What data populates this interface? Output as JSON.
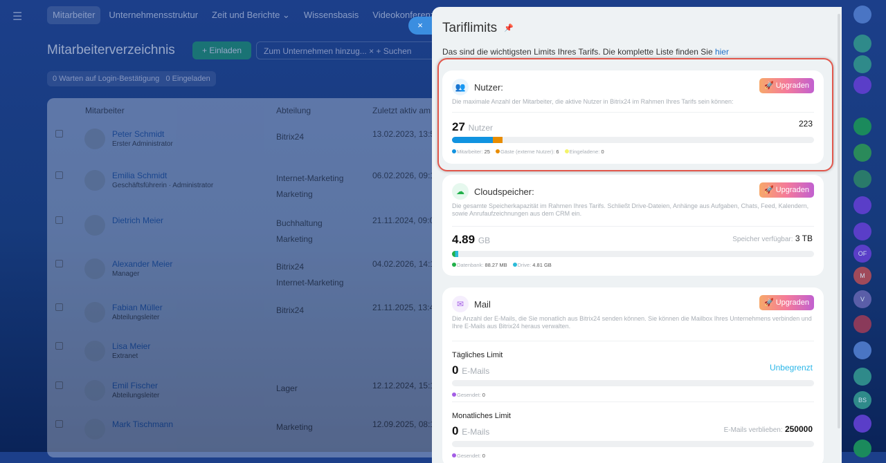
{
  "nav": {
    "tabs": [
      "Mitarbeiter",
      "Unternehmensstruktur",
      "Zeit und Berichte ⌄",
      "Wissensbasis",
      "Videokonferenzen"
    ]
  },
  "page": {
    "title": "Mitarbeiterverzeichnis",
    "invite": "+ Einladen",
    "filter": "Zum Unternehmen hinzug...  ×  + Suchen",
    "chip1": "0 Warten auf Login-Bestätigung",
    "chip2": "0 Eingeladen"
  },
  "table": {
    "headers": [
      "Mitarbeiter",
      "Abteilung",
      "Zuletzt aktiv am"
    ],
    "rows": [
      {
        "name": "Peter Schmidt",
        "pos": "Erster Administrator",
        "dep": "Bitrix24",
        "date": "13.02.2023, 13:5"
      },
      {
        "name": "Emilia Schmidt",
        "pos": "Geschäftsführerin · Administrator",
        "dep": "Internet-Marketing\nMarketing",
        "date": "06.02.2026, 09:1"
      },
      {
        "name": "Dietrich Meier",
        "pos": "",
        "dep": "Buchhaltung\nMarketing",
        "date": "21.11.2024, 09:0"
      },
      {
        "name": "Alexander Meier",
        "pos": "Manager",
        "dep": "Bitrix24\nInternet-Marketing",
        "date": "04.02.2026, 14:1"
      },
      {
        "name": "Fabian Müller",
        "pos": "Abteilungsleiter",
        "dep": "Bitrix24",
        "date": "21.11.2025, 13:4"
      },
      {
        "name": "Lisa Meier",
        "pos": "Extranet",
        "dep": "",
        "date": ""
      },
      {
        "name": "Emil Fischer",
        "pos": "Abteilungsleiter",
        "dep": "Lager",
        "date": "12.12.2024, 15:1"
      },
      {
        "name": "Mark Tischmann",
        "pos": "",
        "dep": "Marketing",
        "date": "12.09.2025, 08:1"
      }
    ]
  },
  "right_sidebar": {
    "badges": [
      "OF",
      "M",
      "V",
      "BS"
    ]
  },
  "panel": {
    "close": "×",
    "title": "Tariflimits",
    "intro": "Das sind die wichtigsten Limits Ihres Tarifs. Die komplette Liste finden Sie ",
    "intro_link": "hier",
    "upgrade": "Upgraden",
    "users": {
      "title": "Nutzer:",
      "desc": "Die maximale Anzahl der Mitarbeiter, die aktive Nutzer in Bitrix24 im Rahmen Ihres Tarifs sein können:",
      "count": "27",
      "unit": "Nutzer",
      "limit": "223",
      "employees_pct": 11.2,
      "guests_pct": 2.7,
      "legend": [
        {
          "label": "Mitarbeiter:",
          "value": "25",
          "color": "#1193e0"
        },
        {
          "label": "Gäste (externe Nutzer):",
          "value": "6",
          "color": "#e88c00"
        },
        {
          "label": "Eingeladene:",
          "value": "0",
          "color": "#f3f36a"
        }
      ]
    },
    "storage": {
      "title": "Cloudspeicher:",
      "desc": "Die gesamte Speicherkapazität im Rahmen Ihres Tarifs. Schließt Drive-Dateien, Anhänge aus Aufgaben, Chats, Feed, Kalendern, sowie Anrufaufzeichnungen aus dem CRM ein.",
      "value": "4.89",
      "unit": "GB",
      "avail_label": "Speicher verfügbar:",
      "avail": "3 TB",
      "legend": [
        {
          "label": "Datenbank:",
          "value": "88.27 MB",
          "color": "#21b04a"
        },
        {
          "label": "Drive:",
          "value": "4.81 GB",
          "color": "#2bbbd8"
        }
      ]
    },
    "mail": {
      "title": "Mail",
      "desc": "Die Anzahl der E-Mails, die Sie monatlich aus Bitrix24 senden können. Sie können die Mailbox Ihres Unternehmens verbinden und Ihre E-Mails aus Bitrix24 heraus verwalten.",
      "daily_title": "Tägliches Limit",
      "daily_value": "0",
      "unit": "E-Mails",
      "daily_limit": "Unbegrenzt",
      "sent_label": "Gesendet:",
      "daily_sent": "0",
      "monthly_title": "Monatliches Limit",
      "monthly_value": "0",
      "remaining_label": "E-Mails verblieben:",
      "remaining": "250000",
      "monthly_sent": "0"
    }
  }
}
